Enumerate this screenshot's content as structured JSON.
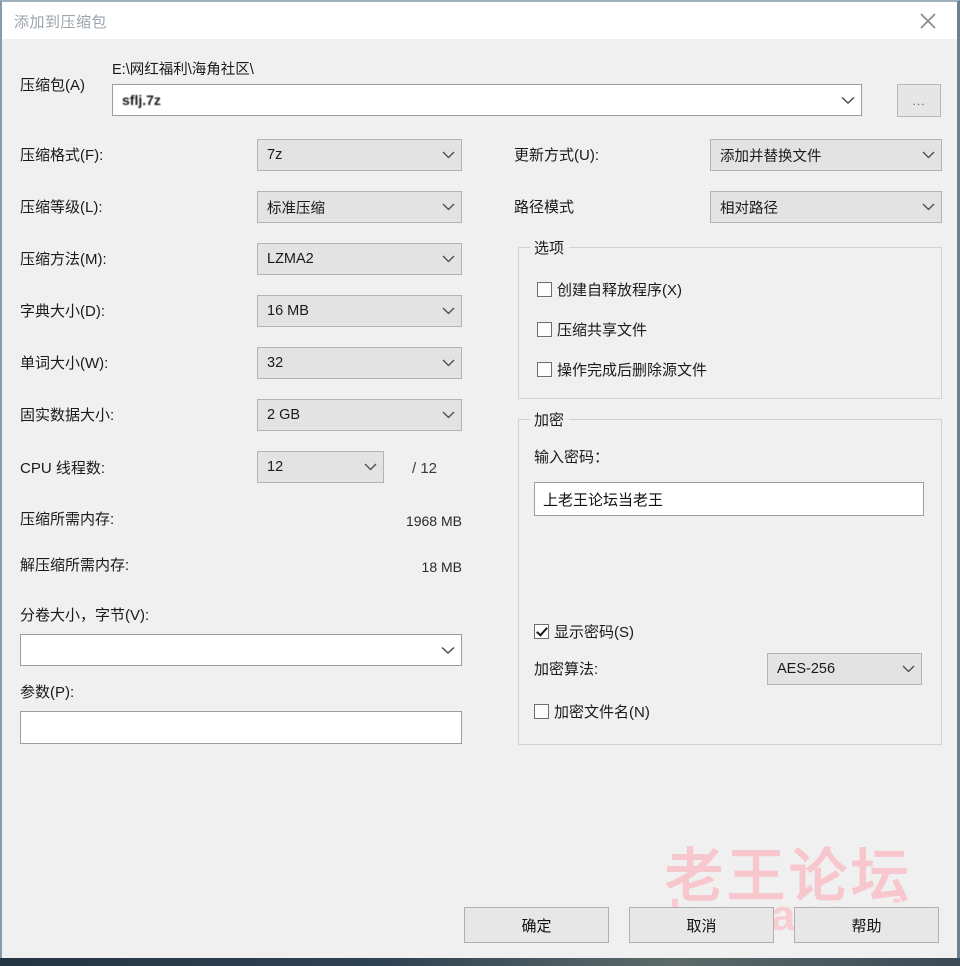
{
  "window": {
    "title": "添加到压缩包",
    "close_icon": "close-icon"
  },
  "archive": {
    "label": "压缩包(A)",
    "path": "E:\\网红福利\\海角社区\\",
    "name": "sflj.7z",
    "browse_label": "..."
  },
  "left_fields": [
    {
      "label": "压缩格式(F):",
      "value": "7z"
    },
    {
      "label": "压缩等级(L):",
      "value": "标准压缩"
    },
    {
      "label": "压缩方法(M):",
      "value": "LZMA2"
    },
    {
      "label": "字典大小(D):",
      "value": "16 MB"
    },
    {
      "label": "单词大小(W):",
      "value": "32"
    },
    {
      "label": "固实数据大小:",
      "value": "2 GB"
    }
  ],
  "cpu": {
    "label": "CPU 线程数:",
    "value": "12",
    "total": "/ 12"
  },
  "memory": {
    "compress_label": "压缩所需内存:",
    "compress_value": "1968 MB",
    "decompress_label": "解压缩所需内存:",
    "decompress_value": "18 MB"
  },
  "split": {
    "label": "分卷大小，字节(V):",
    "value": ""
  },
  "params": {
    "label": "参数(P):",
    "value": ""
  },
  "right_fields": [
    {
      "label": "更新方式(U):",
      "value": "添加并替换文件"
    },
    {
      "label": "路径模式",
      "value": "相对路径"
    }
  ],
  "options": {
    "title": "选项",
    "items": [
      {
        "label": "创建自释放程序(X)",
        "checked": false
      },
      {
        "label": "压缩共享文件",
        "checked": false
      },
      {
        "label": "操作完成后删除源文件",
        "checked": false
      }
    ]
  },
  "encryption": {
    "title": "加密",
    "password_label": "输入密码：",
    "password_value": "上老王论坛当老王",
    "show_password": {
      "label": "显示密码(S)",
      "checked": true
    },
    "algorithm_label": "加密算法:",
    "algorithm_value": "AES-256",
    "encrypt_names": {
      "label": "加密文件名(N)",
      "checked": false
    }
  },
  "buttons": {
    "ok": "确定",
    "cancel": "取消",
    "help": "帮助"
  },
  "watermark": {
    "main": "老王论坛",
    "sub": "laowang.vip",
    "color": "#f8c6cd"
  }
}
